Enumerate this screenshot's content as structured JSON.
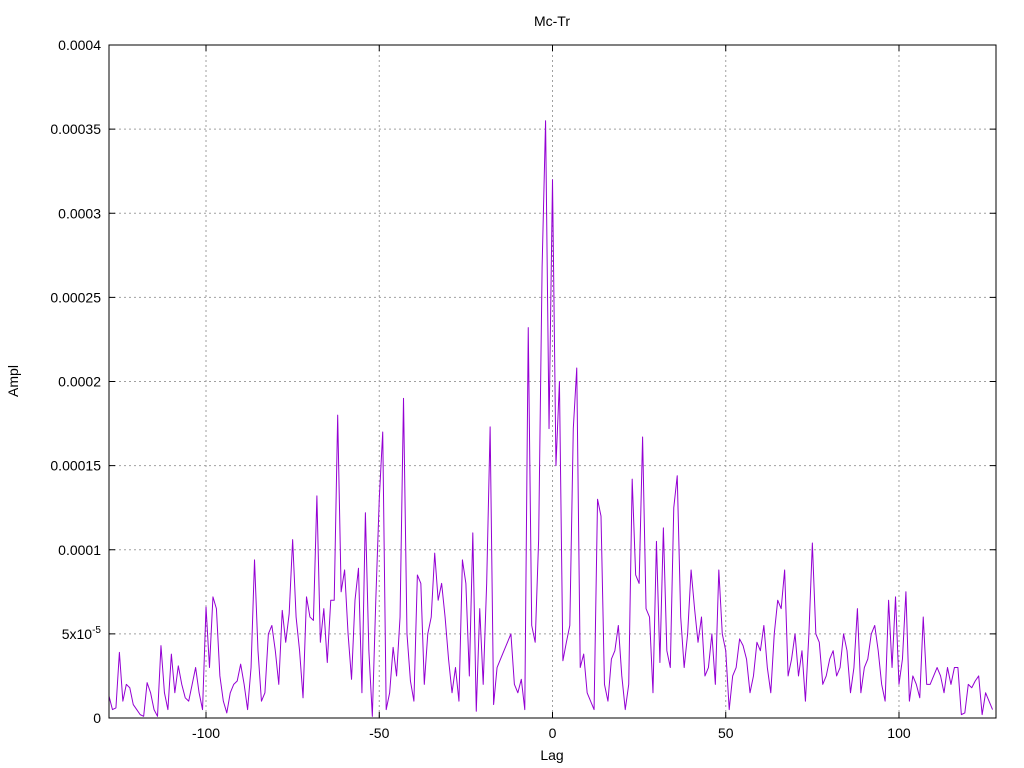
{
  "chart_data": {
    "type": "line",
    "title": "Mc-Tr",
    "xlabel": "Lag",
    "ylabel": "Ampl",
    "xlim": [
      -128,
      128
    ],
    "ylim": [
      0,
      0.0004
    ],
    "grid": true,
    "x_ticks": [
      {
        "value": -100,
        "label": "-100"
      },
      {
        "value": -50,
        "label": "-50"
      },
      {
        "value": 0,
        "label": "0"
      },
      {
        "value": 50,
        "label": "50"
      },
      {
        "value": 100,
        "label": "100"
      }
    ],
    "y_ticks": [
      {
        "value": 0,
        "label": "0"
      },
      {
        "value": 5e-05,
        "label": "5x10",
        "sup": "-5"
      },
      {
        "value": 0.0001,
        "label": "0.0001"
      },
      {
        "value": 0.00015,
        "label": "0.00015"
      },
      {
        "value": 0.0002,
        "label": "0.0002"
      },
      {
        "value": 0.00025,
        "label": "0.00025"
      },
      {
        "value": 0.0003,
        "label": "0.0003"
      },
      {
        "value": 0.00035,
        "label": "0.00035"
      },
      {
        "value": 0.0004,
        "label": "0.0004"
      }
    ],
    "series": [
      {
        "color": "#9400d3",
        "points": [
          [
            -128,
            1.3e-05
          ],
          [
            -127,
            5e-06
          ],
          [
            -126,
            6e-06
          ],
          [
            -125,
            3.9e-05
          ],
          [
            -124,
            1e-05
          ],
          [
            -123,
            2e-05
          ],
          [
            -122,
            1.8e-05
          ],
          [
            -121,
            8e-06
          ],
          [
            -120,
            5e-06
          ],
          [
            -119,
            2e-06
          ],
          [
            -118,
            1e-06
          ],
          [
            -117,
            2.1e-05
          ],
          [
            -116,
            1.5e-05
          ],
          [
            -115,
            5e-06
          ],
          [
            -114,
            1e-06
          ],
          [
            -113,
            4.3e-05
          ],
          [
            -112,
            1.5e-05
          ],
          [
            -111,
            5e-06
          ],
          [
            -110,
            3.8e-05
          ],
          [
            -109,
            1.5e-05
          ],
          [
            -108,
            3.1e-05
          ],
          [
            -107,
            2e-05
          ],
          [
            -106,
            1.2e-05
          ],
          [
            -105,
            1e-05
          ],
          [
            -104,
            2e-05
          ],
          [
            -103,
            3e-05
          ],
          [
            -102,
            1.5e-05
          ],
          [
            -101,
            5e-06
          ],
          [
            -100,
            6.6e-05
          ],
          [
            -99,
            3e-05
          ],
          [
            -98,
            7.2e-05
          ],
          [
            -97,
            6.5e-05
          ],
          [
            -96,
            2.5e-05
          ],
          [
            -95,
            1e-05
          ],
          [
            -94,
            3e-06
          ],
          [
            -93,
            1.5e-05
          ],
          [
            -92,
            2e-05
          ],
          [
            -91,
            2.2e-05
          ],
          [
            -90,
            3.2e-05
          ],
          [
            -89,
            2e-05
          ],
          [
            -88,
            5e-06
          ],
          [
            -87,
            3e-05
          ],
          [
            -86,
            9.4e-05
          ],
          [
            -85,
            4e-05
          ],
          [
            -84,
            1e-05
          ],
          [
            -83,
            1.5e-05
          ],
          [
            -82,
            5e-05
          ],
          [
            -81,
            5.5e-05
          ],
          [
            -80,
            4e-05
          ],
          [
            -79,
            2e-05
          ],
          [
            -78,
            6.4e-05
          ],
          [
            -77,
            4.5e-05
          ],
          [
            -76,
            6.2e-05
          ],
          [
            -75,
            0.000106
          ],
          [
            -74,
            6e-05
          ],
          [
            -73,
            4e-05
          ],
          [
            -72,
            1.2e-05
          ],
          [
            -71,
            7.2e-05
          ],
          [
            -70,
            6e-05
          ],
          [
            -69,
            5.8e-05
          ],
          [
            -68,
            0.000132
          ],
          [
            -67,
            4.5e-05
          ],
          [
            -66,
            6.5e-05
          ],
          [
            -65,
            3.3e-05
          ],
          [
            -64,
            7e-05
          ],
          [
            -63,
            7e-05
          ],
          [
            -62,
            0.00018
          ],
          [
            -61,
            7.5e-05
          ],
          [
            -60,
            8.8e-05
          ],
          [
            -59,
            5e-05
          ],
          [
            -58,
            2.3e-05
          ],
          [
            -57,
            7e-05
          ],
          [
            -56,
            8.9e-05
          ],
          [
            -55,
            1.5e-05
          ],
          [
            -54,
            0.000122
          ],
          [
            -53,
            4e-05
          ],
          [
            -52,
            1e-06
          ],
          [
            -51,
            7e-05
          ],
          [
            -50,
            0.00013
          ],
          [
            -49,
            0.00017
          ],
          [
            -48,
            5e-06
          ],
          [
            -47,
            1.5e-05
          ],
          [
            -46,
            4.2e-05
          ],
          [
            -45,
            2.5e-05
          ],
          [
            -44,
            6e-05
          ],
          [
            -43,
            0.00019
          ],
          [
            -42,
            5e-05
          ],
          [
            -41,
            2.2e-05
          ],
          [
            -40,
            1e-05
          ],
          [
            -39,
            8.5e-05
          ],
          [
            -38,
            8e-05
          ],
          [
            -37,
            2e-05
          ],
          [
            -36,
            5e-05
          ],
          [
            -35,
            6e-05
          ],
          [
            -34,
            9.8e-05
          ],
          [
            -33,
            7e-05
          ],
          [
            -32,
            8e-05
          ],
          [
            -31,
            6e-05
          ],
          [
            -30,
            3.5e-05
          ],
          [
            -29,
            1.5e-05
          ],
          [
            -28,
            3e-05
          ],
          [
            -27,
            1e-05
          ],
          [
            -26,
            9.4e-05
          ],
          [
            -25,
            8e-05
          ],
          [
            -24,
            2.5e-05
          ],
          [
            -23,
            0.00011
          ],
          [
            -22,
            4e-06
          ],
          [
            -21,
            6.5e-05
          ],
          [
            -20,
            2e-05
          ],
          [
            -19,
            8e-05
          ],
          [
            -18,
            0.000173
          ],
          [
            -17,
            8e-06
          ],
          [
            -16,
            3e-05
          ],
          [
            -15,
            3.5e-05
          ],
          [
            -14,
            4e-05
          ],
          [
            -13,
            4.5e-05
          ],
          [
            -12,
            5e-05
          ],
          [
            -11,
            2e-05
          ],
          [
            -10,
            1.5e-05
          ],
          [
            -9,
            2.3e-05
          ],
          [
            -8,
            5e-06
          ],
          [
            -7,
            0.000232
          ],
          [
            -6,
            5.5e-05
          ],
          [
            -5,
            4.5e-05
          ],
          [
            -4,
            0.000106
          ],
          [
            -3,
            0.000268
          ],
          [
            -2,
            0.000355
          ],
          [
            -1,
            0.000172
          ],
          [
            0,
            0.00032
          ],
          [
            1,
            0.00015
          ],
          [
            2,
            0.0002
          ],
          [
            3,
            3.4e-05
          ],
          [
            4,
            4.5e-05
          ],
          [
            5,
            5.5e-05
          ],
          [
            6,
            0.000172
          ],
          [
            7,
            0.000208
          ],
          [
            8,
            3e-05
          ],
          [
            9,
            3.8e-05
          ],
          [
            10,
            1.5e-05
          ],
          [
            11,
            1e-05
          ],
          [
            12,
            5e-06
          ],
          [
            13,
            0.00013
          ],
          [
            14,
            0.00012
          ],
          [
            15,
            2e-05
          ],
          [
            16,
            1e-05
          ],
          [
            17,
            3.5e-05
          ],
          [
            18,
            4e-05
          ],
          [
            19,
            5.5e-05
          ],
          [
            20,
            2.5e-05
          ],
          [
            21,
            5e-06
          ],
          [
            22,
            2e-05
          ],
          [
            23,
            0.000142
          ],
          [
            24,
            8.5e-05
          ],
          [
            25,
            8e-05
          ],
          [
            26,
            0.000167
          ],
          [
            27,
            6.5e-05
          ],
          [
            28,
            6e-05
          ],
          [
            29,
            1.5e-05
          ],
          [
            30,
            0.000105
          ],
          [
            31,
            3.3e-05
          ],
          [
            32,
            0.000113
          ],
          [
            33,
            4e-05
          ],
          [
            34,
            3e-05
          ],
          [
            35,
            0.000125
          ],
          [
            36,
            0.000144
          ],
          [
            37,
            6e-05
          ],
          [
            38,
            3e-05
          ],
          [
            39,
            5e-05
          ],
          [
            40,
            8.8e-05
          ],
          [
            41,
            6.5e-05
          ],
          [
            42,
            4.5e-05
          ],
          [
            43,
            6e-05
          ],
          [
            44,
            2.5e-05
          ],
          [
            45,
            3e-05
          ],
          [
            46,
            5e-05
          ],
          [
            47,
            2e-05
          ],
          [
            48,
            8.8e-05
          ],
          [
            49,
            5e-05
          ],
          [
            50,
            4e-05
          ],
          [
            51,
            5e-06
          ],
          [
            52,
            2.5e-05
          ],
          [
            53,
            3e-05
          ],
          [
            54,
            4.7e-05
          ],
          [
            55,
            4.3e-05
          ],
          [
            56,
            3.5e-05
          ],
          [
            57,
            1.5e-05
          ],
          [
            58,
            2.5e-05
          ],
          [
            59,
            4.5e-05
          ],
          [
            60,
            4e-05
          ],
          [
            61,
            5.5e-05
          ],
          [
            62,
            3e-05
          ],
          [
            63,
            1.5e-05
          ],
          [
            64,
            5e-05
          ],
          [
            65,
            7e-05
          ],
          [
            66,
            6.5e-05
          ],
          [
            67,
            8.8e-05
          ],
          [
            68,
            2.5e-05
          ],
          [
            69,
            3.5e-05
          ],
          [
            70,
            5e-05
          ],
          [
            71,
            2.5e-05
          ],
          [
            72,
            4e-05
          ],
          [
            73,
            1e-05
          ],
          [
            74,
            5e-05
          ],
          [
            75,
            0.000104
          ],
          [
            76,
            5e-05
          ],
          [
            77,
            4.5e-05
          ],
          [
            78,
            2e-05
          ],
          [
            79,
            2.5e-05
          ],
          [
            80,
            3.5e-05
          ],
          [
            81,
            4e-05
          ],
          [
            82,
            2.5e-05
          ],
          [
            83,
            3e-05
          ],
          [
            84,
            5e-05
          ],
          [
            85,
            4e-05
          ],
          [
            86,
            1.5e-05
          ],
          [
            87,
            3e-05
          ],
          [
            88,
            6.5e-05
          ],
          [
            89,
            1.5e-05
          ],
          [
            90,
            3e-05
          ],
          [
            91,
            3.5e-05
          ],
          [
            92,
            5e-05
          ],
          [
            93,
            5.5e-05
          ],
          [
            94,
            4e-05
          ],
          [
            95,
            2e-05
          ],
          [
            96,
            1e-05
          ],
          [
            97,
            7e-05
          ],
          [
            98,
            3e-05
          ],
          [
            99,
            7.2e-05
          ],
          [
            100,
            2e-05
          ],
          [
            101,
            3.5e-05
          ],
          [
            102,
            7.5e-05
          ],
          [
            103,
            1e-05
          ],
          [
            104,
            2.5e-05
          ],
          [
            105,
            2e-05
          ],
          [
            106,
            1.2e-05
          ],
          [
            107,
            6e-05
          ],
          [
            108,
            2e-05
          ],
          [
            109,
            2e-05
          ],
          [
            110,
            2.5e-05
          ],
          [
            111,
            3e-05
          ],
          [
            112,
            2.5e-05
          ],
          [
            113,
            1.5e-05
          ],
          [
            114,
            3e-05
          ],
          [
            115,
            2e-05
          ],
          [
            116,
            3e-05
          ],
          [
            117,
            3e-05
          ],
          [
            118,
            2e-06
          ],
          [
            119,
            3e-06
          ],
          [
            120,
            2e-05
          ],
          [
            121,
            1.8e-05
          ],
          [
            122,
            2.2e-05
          ],
          [
            123,
            2.5e-05
          ],
          [
            124,
            2e-06
          ],
          [
            125,
            1.5e-05
          ],
          [
            126,
            1e-05
          ],
          [
            127,
            5e-06
          ]
        ]
      }
    ]
  }
}
